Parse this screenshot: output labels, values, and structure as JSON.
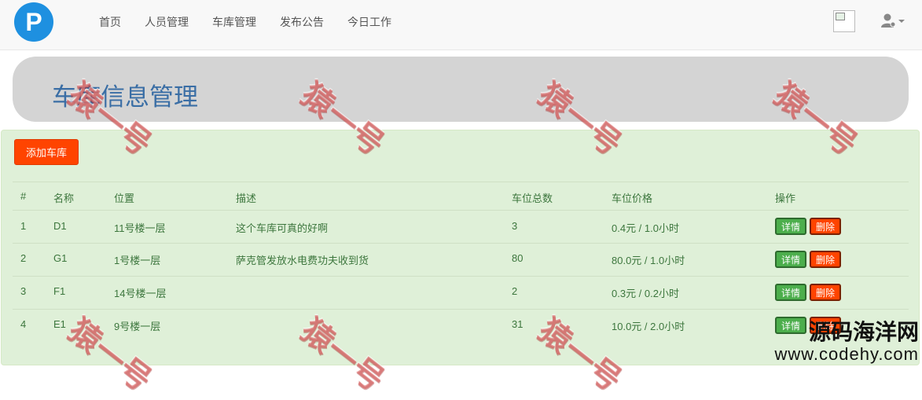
{
  "nav": {
    "logo_letter": "P",
    "items": [
      "首页",
      "人员管理",
      "车库管理",
      "发布公告",
      "今日工作"
    ]
  },
  "page_title": "车库信息管理",
  "add_button": "添加车库",
  "table": {
    "headers": [
      "#",
      "名称",
      "位置",
      "描述",
      "车位总数",
      "车位价格",
      "操作"
    ],
    "rows": [
      {
        "id": "1",
        "name": "D1",
        "location": "11号楼一层",
        "desc": "这个车库可真的好啊",
        "total": "3",
        "price": "0.4元 / 1.0小时"
      },
      {
        "id": "2",
        "name": "G1",
        "location": "1号楼一层",
        "desc": "萨克管发放水电费功夫收到货",
        "total": "80",
        "price": "80.0元 / 1.0小时"
      },
      {
        "id": "3",
        "name": "F1",
        "location": "14号楼一层",
        "desc": "",
        "total": "2",
        "price": "0.3元 / 0.2小时"
      },
      {
        "id": "4",
        "name": "E1",
        "location": "9号楼一层",
        "desc": "",
        "total": "31",
        "price": "10.0元 / 2.0小时"
      }
    ],
    "detail_label": "详情",
    "delete_label": "删除"
  },
  "watermark_text": "猿一号",
  "site_mark": {
    "line1": "源码海洋网",
    "line2": "www.codehy.com"
  },
  "colors": {
    "nav_bg": "#f8f8f8",
    "logo": "#1e90e0",
    "panel_bg": "#dff0d8",
    "add_btn": "#ff4400",
    "detail_btn": "#4cae4c",
    "delete_btn": "#ff4400",
    "title": "#3a6ea5"
  }
}
